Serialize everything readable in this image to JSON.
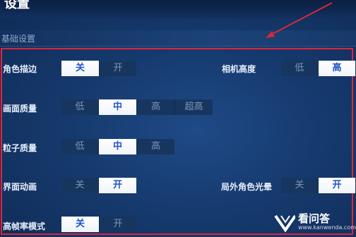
{
  "header": {
    "title": "设置"
  },
  "section": {
    "title": "基础设置"
  },
  "settings": {
    "outline": {
      "label": "角色描边",
      "options": [
        "关",
        "开"
      ],
      "selected": "关"
    },
    "quality": {
      "label": "画面质量",
      "options": [
        "低",
        "中",
        "高",
        "超高"
      ],
      "selected": "中"
    },
    "particle": {
      "label": "粒子质量",
      "options": [
        "低",
        "中",
        "高"
      ],
      "selected": "中"
    },
    "ui_anim": {
      "label": "界面动画",
      "options": [
        "关",
        "开"
      ],
      "selected": "开"
    },
    "hfr": {
      "label": "高帧率模式",
      "options": [
        "关",
        "开"
      ],
      "selected": "关"
    },
    "camera": {
      "label": "相机高度",
      "options": [
        "低",
        "高"
      ],
      "selected": "高"
    },
    "halo": {
      "label": "局外角色光晕",
      "options": [
        "关",
        "开"
      ],
      "selected": "开"
    }
  },
  "watermark": {
    "name": "看问答",
    "url": "www.kanwenda.com"
  },
  "colors": {
    "highlight": "#e0243a",
    "selected_text": "#1d55c7"
  }
}
